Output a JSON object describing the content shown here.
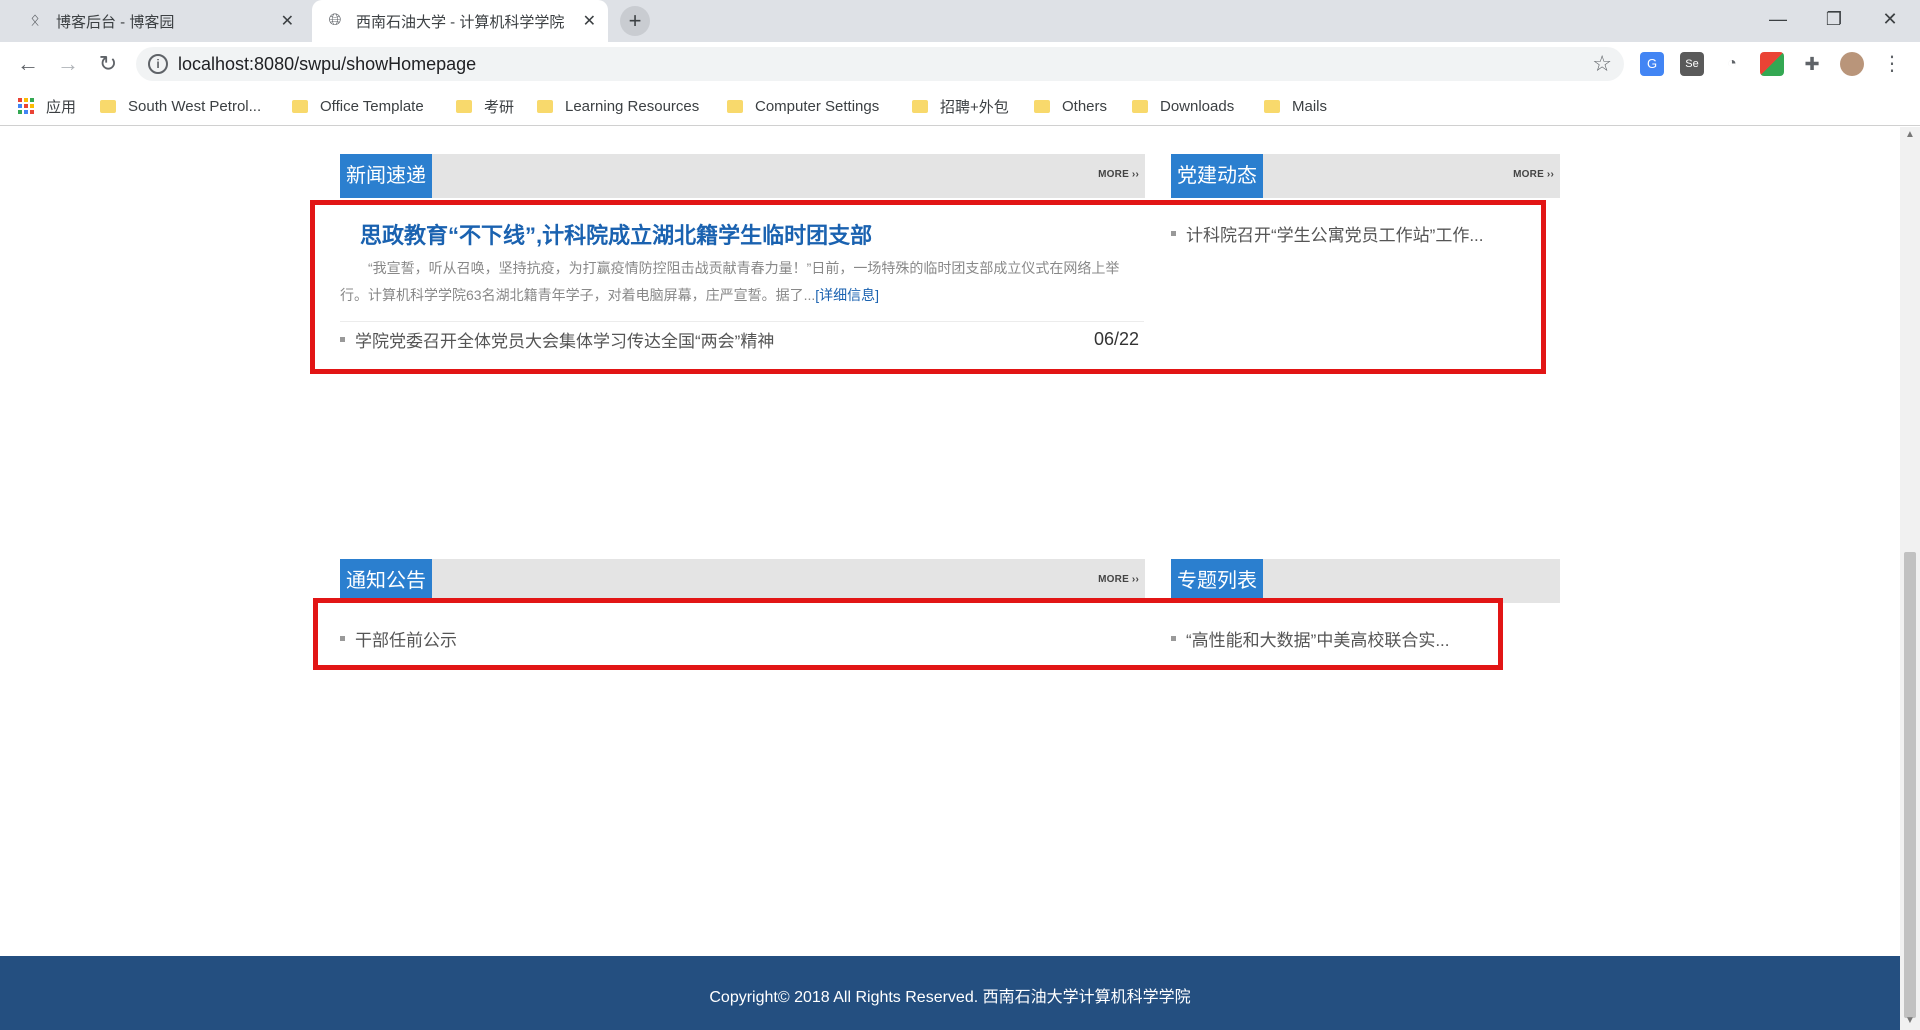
{
  "browser": {
    "tabs": [
      {
        "title": "博客后台 - 博客园",
        "icon": "blog-icon"
      },
      {
        "title": "西南石油大学 - 计算机科学学院",
        "icon": "globe-icon"
      }
    ],
    "new_tab_label": "+",
    "window": {
      "minimize": "—",
      "restore": "❐",
      "close": "✕"
    },
    "url": "localhost:8080/swpu/showHomepage",
    "nav": {
      "back": "←",
      "forward": "→",
      "reload": "↻"
    },
    "bookmark_star": "☆",
    "menu": "⋮",
    "bookmarks": [
      {
        "label": "应用",
        "type": "apps"
      },
      {
        "label": "South West Petrol...",
        "type": "folder"
      },
      {
        "label": "Office Template",
        "type": "folder"
      },
      {
        "label": "考研",
        "type": "folder"
      },
      {
        "label": "Learning Resources",
        "type": "folder"
      },
      {
        "label": "Computer Settings",
        "type": "folder"
      },
      {
        "label": "招聘+外包",
        "type": "folder"
      },
      {
        "label": "Others",
        "type": "folder"
      },
      {
        "label": "Downloads",
        "type": "folder"
      },
      {
        "label": "Mails",
        "type": "folder"
      }
    ]
  },
  "page": {
    "news": {
      "title": "新闻速递",
      "more": "MORE",
      "headline": "思政教育“不下线”,计科院成立湖北籍学生临时团支部",
      "summary": "“我宣誓，听从召唤，坚持抗疫，为打赢疫情防控阻击战贡献青春力量！”日前，一场特殊的临时团支部成立仪式在网络上举行。计算机科学学院63名湖北籍青年学子，对着电脑屏幕，庄严宣誓。据了...",
      "detail_link": "[详细信息]",
      "items": [
        {
          "text": "学院党委召开全体党员大会集体学习传达全国“两会”精神",
          "date": "06/22"
        }
      ]
    },
    "party": {
      "title": "党建动态",
      "more": "MORE",
      "items": [
        {
          "text": "计科院召开“学生公寓党员工作站”工作..."
        }
      ]
    },
    "notice": {
      "title": "通知公告",
      "more": "MORE",
      "items": [
        {
          "text": "干部任前公示"
        }
      ]
    },
    "topics": {
      "title": "专题列表",
      "items": [
        {
          "text": "“高性能和大数据”中美高校联合实..."
        }
      ]
    },
    "footer": {
      "copyright": "Copyright© 2018 All Rights Reserved. 西南石油大学计算机科学学院"
    }
  },
  "colors": {
    "section_title_bg": "#2b7fcf",
    "section_bar_bg": "#e4e4e4",
    "headline": "#1a62b0",
    "footer_bg": "#244f80",
    "highlight_box": "#e21515"
  }
}
